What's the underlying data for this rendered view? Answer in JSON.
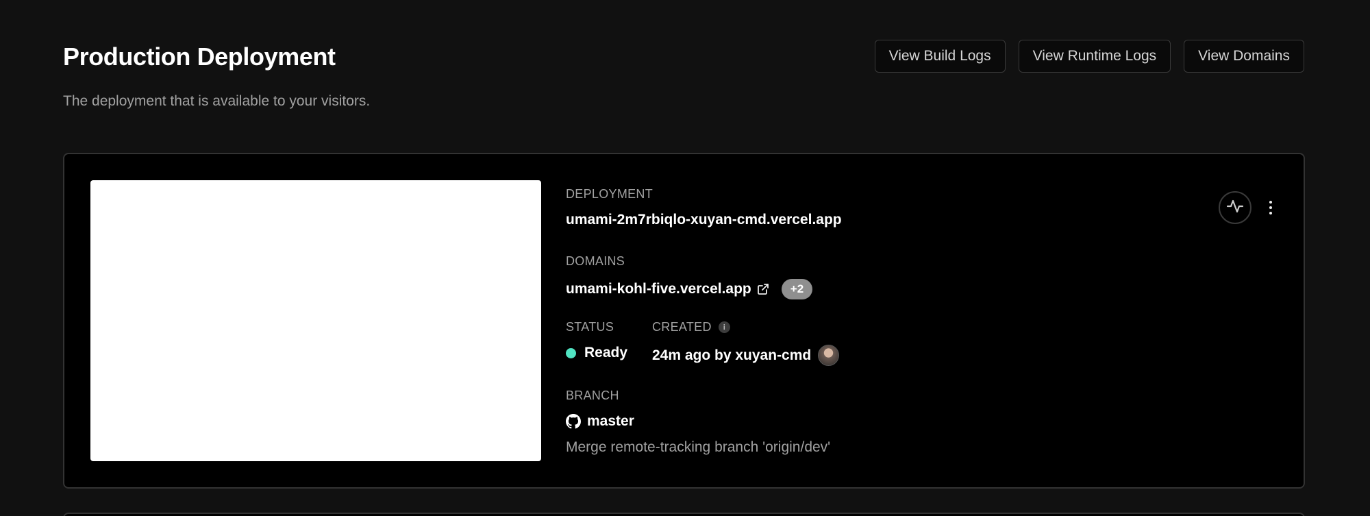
{
  "header": {
    "title": "Production Deployment",
    "subtitle": "The deployment that is available to your visitors.",
    "buttons": {
      "build_logs": "View Build Logs",
      "runtime_logs": "View Runtime Logs",
      "domains": "View Domains"
    }
  },
  "deployment": {
    "label": "DEPLOYMENT",
    "url": "umami-2m7rbiqlo-xuyan-cmd.vercel.app"
  },
  "domains": {
    "label": "DOMAINS",
    "primary": "umami-kohl-five.vercel.app",
    "extra_count": "+2"
  },
  "status": {
    "label": "STATUS",
    "value": "Ready",
    "color": "#50e3c2"
  },
  "created": {
    "label": "CREATED",
    "info_glyph": "i",
    "value": "24m ago by xuyan-cmd"
  },
  "branch": {
    "label": "BRANCH",
    "name": "master",
    "commit_message": "Merge remote-tracking branch 'origin/dev'"
  },
  "icons": {
    "external": "external-link-icon",
    "github": "github-icon",
    "activity": "activity-icon",
    "more": "more-vertical-icon"
  }
}
